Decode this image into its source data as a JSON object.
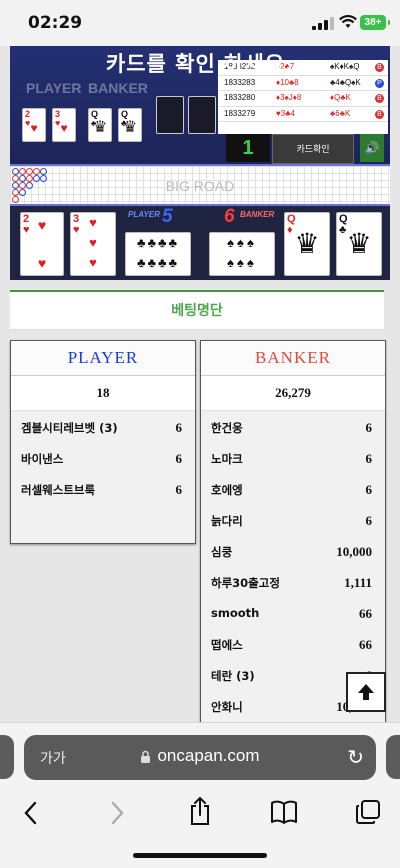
{
  "status_bar": {
    "time": "02:29",
    "battery": "38+"
  },
  "game": {
    "overlay_title": "카드를 확인 하세요.",
    "ghost_labels": [
      "PLAYER",
      "BANKER"
    ],
    "history": [
      {
        "id": "1833282",
        "player": "♦2♣7",
        "banker": "♠K♦K♠Q",
        "result": "B",
        "color": "#d23131"
      },
      {
        "id": "1833283",
        "player": "♦10♣8",
        "banker": "♣4♣Q♠K",
        "result": "P",
        "color": "#2a4adf"
      },
      {
        "id": "1833280",
        "player": "♦3♠J♦8",
        "banker": "♦Q♣K",
        "result": "B",
        "color": "#d23131"
      },
      {
        "id": "1833279",
        "player": "♥3♣4",
        "banker": "♣6♣K",
        "result": "B",
        "color": "#d23131"
      }
    ],
    "counter": "1",
    "confirm_label": "카드확인",
    "road_label": "BIG ROAD",
    "player_tag": "PLAYER",
    "player_score": "5",
    "banker_tag": "BANKER",
    "banker_score": "6",
    "accent_player": "#3a64ff",
    "accent_banker": "#ff3b3b"
  },
  "betting_tab": "베팅명단",
  "player_panel": {
    "title": "PLAYER",
    "total": "18",
    "rows": [
      {
        "name": "겜블시티레브벳 (3)",
        "amount": "6"
      },
      {
        "name": "바이낸스",
        "amount": "6"
      },
      {
        "name": "러셀웨스트브룩",
        "amount": "6"
      }
    ]
  },
  "banker_panel": {
    "title": "BANKER",
    "total": "26,279",
    "rows": [
      {
        "name": "한건웅",
        "amount": "6"
      },
      {
        "name": "노마크",
        "amount": "6"
      },
      {
        "name": "호에엥",
        "amount": "6"
      },
      {
        "name": "늙다리",
        "amount": "6"
      },
      {
        "name": "심쿵",
        "amount": "10,000"
      },
      {
        "name": "하루30출고정",
        "amount": "1,111"
      },
      {
        "name": "smooth",
        "amount": "66"
      },
      {
        "name": "떱에스",
        "amount": "66"
      },
      {
        "name": "테란 (3)",
        "amount": "6"
      },
      {
        "name": "안화니",
        "amount": "10,000"
      }
    ]
  },
  "browser": {
    "text_size_label": "가가",
    "domain": "oncapan.com"
  },
  "colors": {
    "player": "#1a3ad6",
    "banker": "#e0493c",
    "tab_green": "#4fa84f"
  }
}
